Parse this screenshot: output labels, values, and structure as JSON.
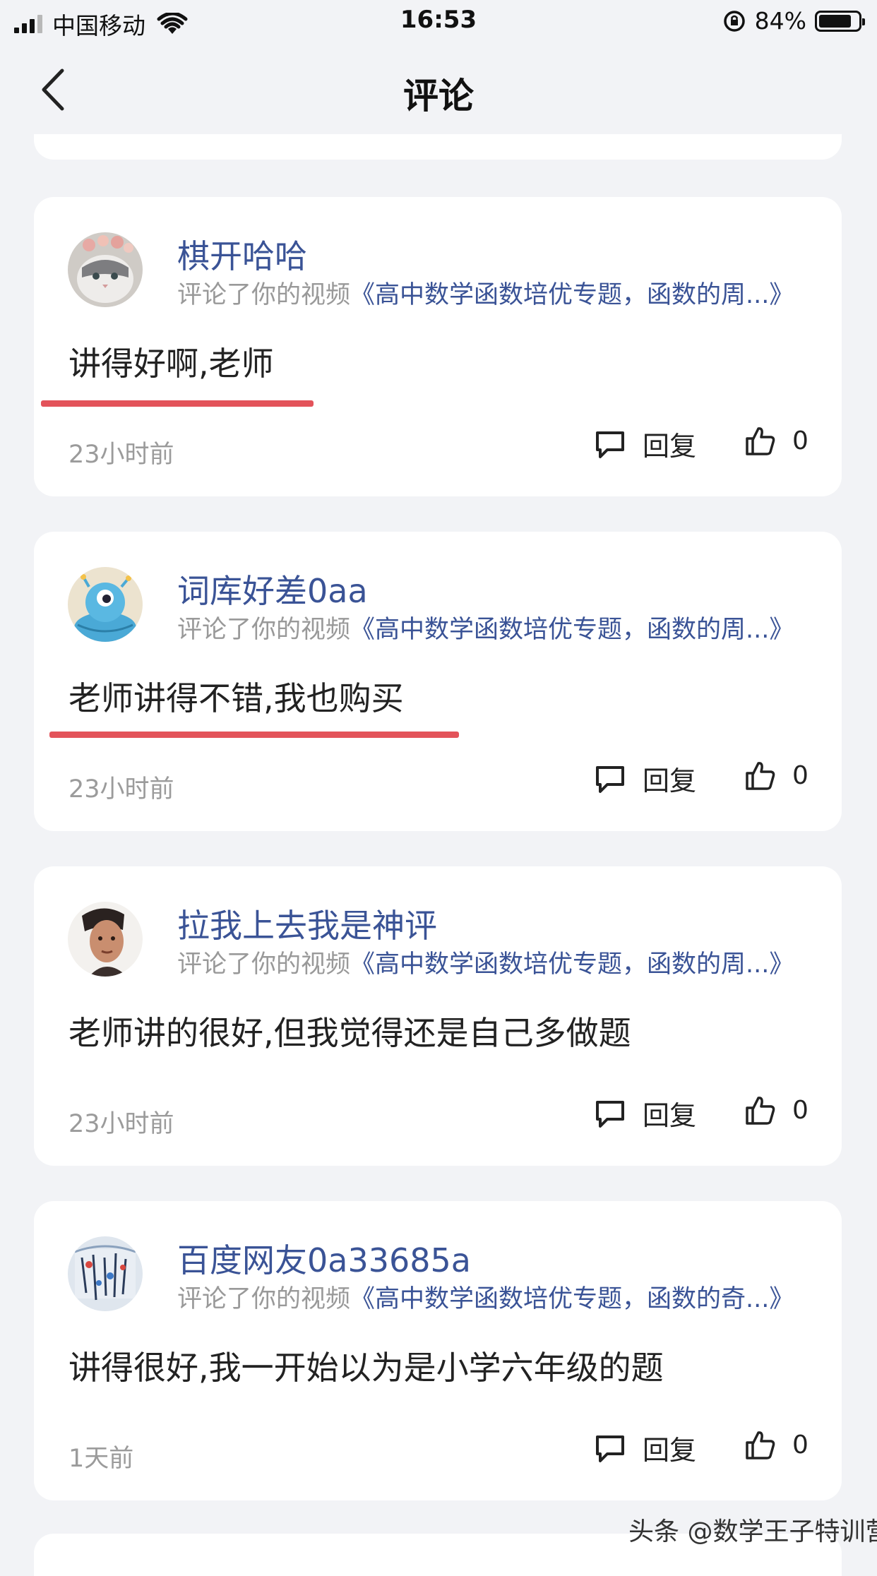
{
  "status_bar": {
    "carrier": "中国移动",
    "time": "16:53",
    "battery_percent": "84%",
    "battery_level": 0.84
  },
  "nav": {
    "title": "评论"
  },
  "comments": [
    {
      "username": "棋开哈哈",
      "prefix": "评论了你的视频",
      "video_title": "《高中数学函数培优专题，函数的周...》",
      "content": "讲得好啊,老师",
      "time": "23小时前",
      "reply_label": "回复",
      "likes": "0"
    },
    {
      "username": "词库好差0aa",
      "prefix": "评论了你的视频",
      "video_title": "《高中数学函数培优专题，函数的周...》",
      "content": "老师讲得不错,我也购买",
      "time": "23小时前",
      "reply_label": "回复",
      "likes": "0"
    },
    {
      "username": "拉我上去我是神评",
      "prefix": "评论了你的视频",
      "video_title": "《高中数学函数培优专题，函数的周...》",
      "content": "老师讲的很好,但我觉得还是自己多做题",
      "time": "23小时前",
      "reply_label": "回复",
      "likes": "0"
    },
    {
      "username": "百度网友0a33685a",
      "prefix": "评论了你的视频",
      "video_title": "《高中数学函数培优专题，函数的奇...》",
      "content": "讲得很好,我一开始以为是小学六年级的题",
      "time": "1天前",
      "reply_label": "回复",
      "likes": "0"
    }
  ],
  "watermark": "头条 @数学王子特训营",
  "colors": {
    "username": "#3a5396",
    "underline": "#e3535a",
    "background": "#f2f3f6"
  }
}
